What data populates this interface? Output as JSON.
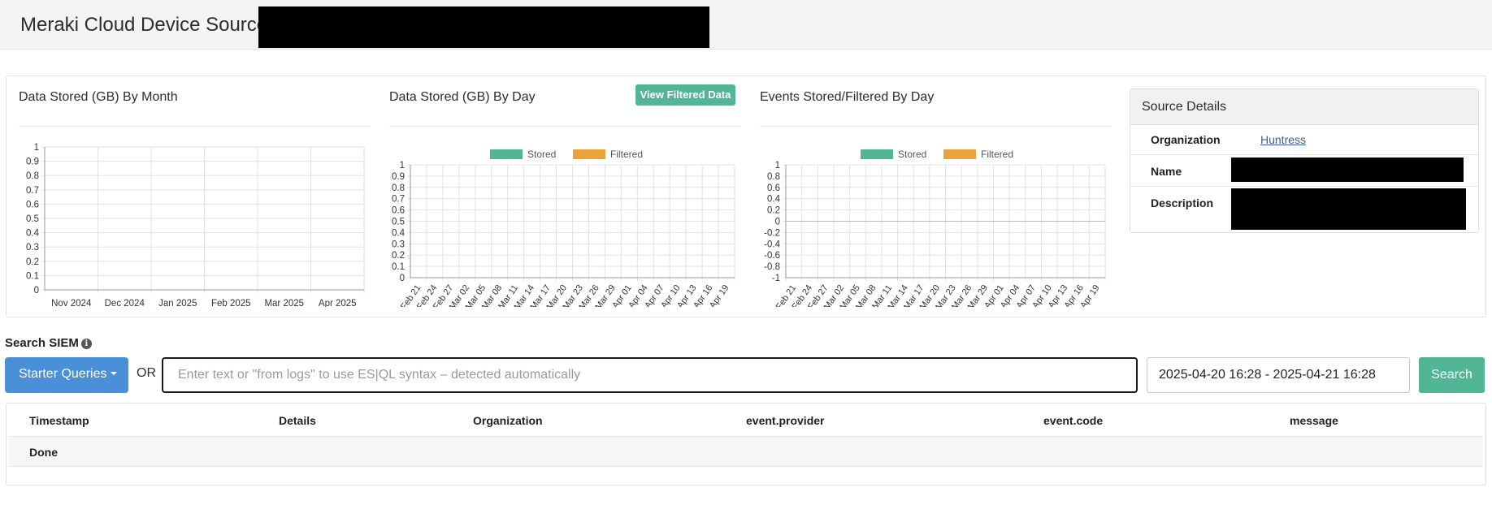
{
  "header": {
    "title": "Meraki Cloud Device Source:"
  },
  "colors": {
    "stored": "#52b596",
    "filtered": "#e8a33a",
    "primary": "#4a90d9"
  },
  "charts": {
    "monthly": {
      "title": "Data Stored (GB) By Month"
    },
    "daily": {
      "title": "Data Stored (GB) By Day",
      "action_label": "View Filtered Data"
    },
    "events": {
      "title": "Events Stored/Filtered By Day"
    }
  },
  "chart_data": [
    {
      "type": "bar",
      "title": "Data Stored (GB) By Month",
      "categories": [
        "Nov 2024",
        "Dec 2024",
        "Jan 2025",
        "Feb 2025",
        "Mar 2025",
        "Apr 2025"
      ],
      "values": [
        0,
        0,
        0,
        0,
        0,
        0
      ],
      "ylim": [
        0,
        1
      ],
      "yticks": [
        "1",
        "0.9",
        "0.8",
        "0.7",
        "0.6",
        "0.5",
        "0.4",
        "0.3",
        "0.2",
        "0.1",
        "0"
      ],
      "grid": true
    },
    {
      "type": "bar",
      "title": "Data Stored (GB) By Day",
      "categories": [
        "Feb 21",
        "Feb 24",
        "Feb 27",
        "Mar 02",
        "Mar 05",
        "Mar 08",
        "Mar 11",
        "Mar 14",
        "Mar 17",
        "Mar 20",
        "Mar 23",
        "Mar 26",
        "Mar 29",
        "Apr 01",
        "Apr 04",
        "Apr 07",
        "Apr 10",
        "Apr 13",
        "Apr 16",
        "Apr 19"
      ],
      "series": [
        {
          "name": "Stored",
          "values": [
            0,
            0,
            0,
            0,
            0,
            0,
            0,
            0,
            0,
            0,
            0,
            0,
            0,
            0,
            0,
            0,
            0,
            0,
            0,
            0
          ]
        },
        {
          "name": "Filtered",
          "values": [
            0,
            0,
            0,
            0,
            0,
            0,
            0,
            0,
            0,
            0,
            0,
            0,
            0,
            0,
            0,
            0,
            0,
            0,
            0,
            0
          ]
        }
      ],
      "ylim": [
        0,
        1
      ],
      "yticks": [
        "1",
        "0.9",
        "0.8",
        "0.7",
        "0.6",
        "0.5",
        "0.4",
        "0.3",
        "0.2",
        "0.1",
        "0"
      ],
      "legend": "top",
      "grid": true
    },
    {
      "type": "bar",
      "title": "Events Stored/Filtered By Day",
      "categories": [
        "Feb 21",
        "Feb 24",
        "Feb 27",
        "Mar 02",
        "Mar 05",
        "Mar 08",
        "Mar 11",
        "Mar 14",
        "Mar 17",
        "Mar 20",
        "Mar 23",
        "Mar 26",
        "Mar 29",
        "Apr 01",
        "Apr 04",
        "Apr 07",
        "Apr 10",
        "Apr 13",
        "Apr 16",
        "Apr 19"
      ],
      "series": [
        {
          "name": "Stored",
          "values": [
            0,
            0,
            0,
            0,
            0,
            0,
            0,
            0,
            0,
            0,
            0,
            0,
            0,
            0,
            0,
            0,
            0,
            0,
            0,
            0
          ]
        },
        {
          "name": "Filtered",
          "values": [
            0,
            0,
            0,
            0,
            0,
            0,
            0,
            0,
            0,
            0,
            0,
            0,
            0,
            0,
            0,
            0,
            0,
            0,
            0,
            0
          ]
        }
      ],
      "ylim": [
        -1,
        1
      ],
      "yticks": [
        "1",
        "0.8",
        "0.6",
        "0.4",
        "0.2",
        "0",
        "-0.2",
        "-0.4",
        "-0.6",
        "-0.8",
        "-1"
      ],
      "legend": "top",
      "grid": true
    }
  ],
  "source_details": {
    "title": "Source Details",
    "organization_label": "Organization",
    "organization_value": "Huntress",
    "name_label": "Name",
    "description_label": "Description"
  },
  "search": {
    "label": "Search SIEM",
    "info_icon": "info-circle-icon",
    "starter_label": "Starter Queries",
    "or_label": "OR",
    "query_placeholder": "Enter text or \"from logs\" to use ES|QL syntax – detected automatically",
    "query_value": "",
    "date_range": "2025-04-20 16:28 - 2025-04-21 16:28",
    "button_label": "Search"
  },
  "results": {
    "columns": [
      "Timestamp",
      "Details",
      "Organization",
      "event.provider",
      "event.code",
      "message"
    ],
    "status": "Done"
  }
}
